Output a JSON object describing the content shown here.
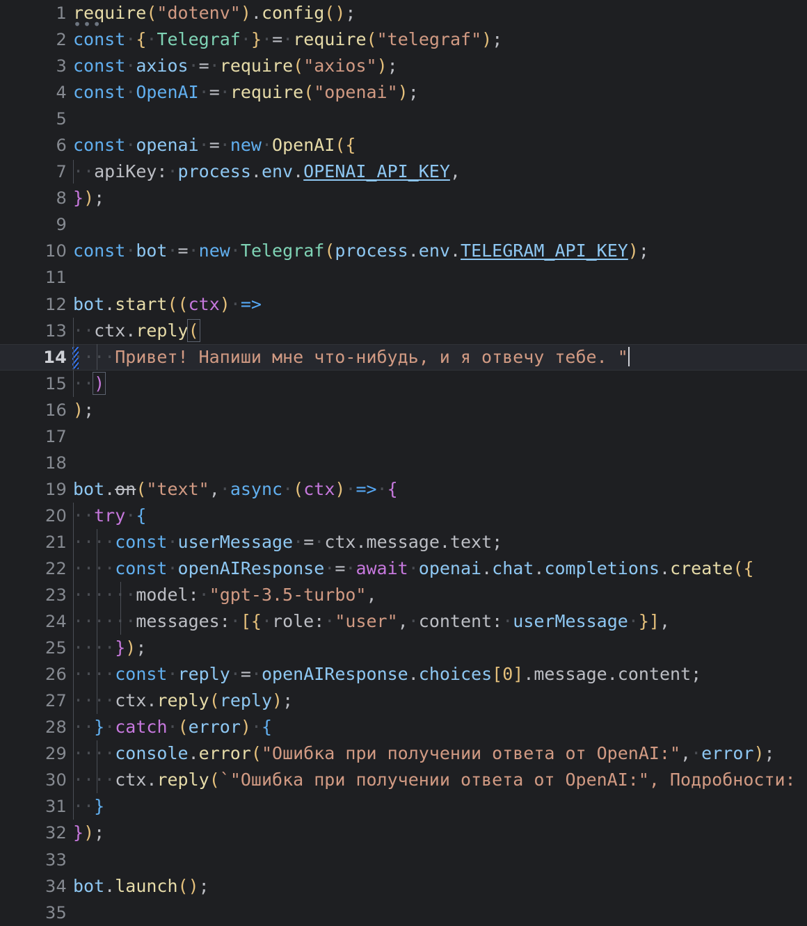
{
  "editor": {
    "language": "javascript",
    "theme": "dark",
    "background": "#1e1f22",
    "active_line": 14,
    "total_visible_lines": 35,
    "gutter_line_numbers": [
      "1",
      "2",
      "3",
      "4",
      "5",
      "6",
      "7",
      "8",
      "9",
      "10",
      "11",
      "12",
      "13",
      "14",
      "15",
      "16",
      "17",
      "18",
      "19",
      "20",
      "21",
      "22",
      "23",
      "24",
      "25",
      "26",
      "27",
      "28",
      "29",
      "30",
      "31",
      "32",
      "33",
      "34",
      "35"
    ],
    "markers": {
      "vcs_change_line": 14,
      "vcs_change_color": "#3574F0",
      "fold_triangle_line": 17,
      "fold_triangle_color": "#E2665C",
      "fold_ellipsis_line": 1
    },
    "colors": {
      "keyword": "#61AFEF",
      "control_keyword": "#C678DD",
      "string": "#D19A83",
      "identifier": "#8EC7F2",
      "function": "#E5C07B",
      "class": "#7FD3B5",
      "punctuation": "#BCBEC4",
      "bracket": "#E5C07B",
      "line_number": "#868A91",
      "active_line_bg": "#26282E",
      "indent_guide": "#4B4F56",
      "whitespace_dot": "#4A4D53"
    }
  },
  "lines": [
    {
      "n": "1",
      "text": "require(\"dotenv\").config();"
    },
    {
      "n": "2",
      "text": "const { Telegraf } = require(\"telegraf\");"
    },
    {
      "n": "3",
      "text": "const axios = require(\"axios\");"
    },
    {
      "n": "4",
      "text": "const OpenAI = require(\"openai\");"
    },
    {
      "n": "5",
      "text": ""
    },
    {
      "n": "6",
      "text": "const openai = new OpenAI({"
    },
    {
      "n": "7",
      "text": "  apiKey: process.env.OPENAI_API_KEY,"
    },
    {
      "n": "8",
      "text": "});"
    },
    {
      "n": "9",
      "text": ""
    },
    {
      "n": "10",
      "text": "const bot = new Telegraf(process.env.TELEGRAM_API_KEY);"
    },
    {
      "n": "11",
      "text": ""
    },
    {
      "n": "12",
      "text": "bot.start((ctx) =>"
    },
    {
      "n": "13",
      "text": "  ctx.reply("
    },
    {
      "n": "14",
      "text": "    \"Привет! Напиши мне что-нибудь, и я отвечу тебе. \""
    },
    {
      "n": "15",
      "text": "  )"
    },
    {
      "n": "16",
      "text": ");"
    },
    {
      "n": "17",
      "text": ""
    },
    {
      "n": "18",
      "text": ""
    },
    {
      "n": "19",
      "text": "bot.on(\"text\", async (ctx) => {"
    },
    {
      "n": "20",
      "text": "  try {"
    },
    {
      "n": "21",
      "text": "    const userMessage = ctx.message.text;"
    },
    {
      "n": "22",
      "text": "    const openAIResponse = await openai.chat.completions.create({"
    },
    {
      "n": "23",
      "text": "      model: \"gpt-3.5-turbo\","
    },
    {
      "n": "24",
      "text": "      messages: [{ role: \"user\", content: userMessage }],"
    },
    {
      "n": "25",
      "text": "    });"
    },
    {
      "n": "26",
      "text": "    const reply = openAIResponse.choices[0].message.content;"
    },
    {
      "n": "27",
      "text": "    ctx.reply(reply);"
    },
    {
      "n": "28",
      "text": "  } catch (error) {"
    },
    {
      "n": "29",
      "text": "    console.error(\"Ошибка при получении ответа от OpenAI:\", error);"
    },
    {
      "n": "30",
      "text": "    ctx.reply(`\"Ошибка при получении ответа от OpenAI:\", Подробности: `);"
    },
    {
      "n": "31",
      "text": "  }"
    },
    {
      "n": "32",
      "text": "});"
    },
    {
      "n": "33",
      "text": ""
    },
    {
      "n": "34",
      "text": "bot.launch();"
    },
    {
      "n": "35",
      "text": ""
    }
  ],
  "strings": {
    "greeting_ru": "Привет! Напиши мне что-нибудь, и я отвечу тебе. ",
    "error_console_ru": "Ошибка при получении ответа от OpenAI:",
    "error_reply_ru": "\"Ошибка при получении ответа от OpenAI:\", Подробности: ",
    "model_name": "gpt-3.5-turbo",
    "role_value": "user",
    "event_name": "text",
    "module_dotenv": "dotenv",
    "module_telegraf": "telegraf",
    "module_axios": "axios",
    "module_openai": "openai"
  },
  "env_vars": {
    "openai_key": "OPENAI_API_KEY",
    "telegram_key": "TELEGRAM_API_KEY"
  }
}
